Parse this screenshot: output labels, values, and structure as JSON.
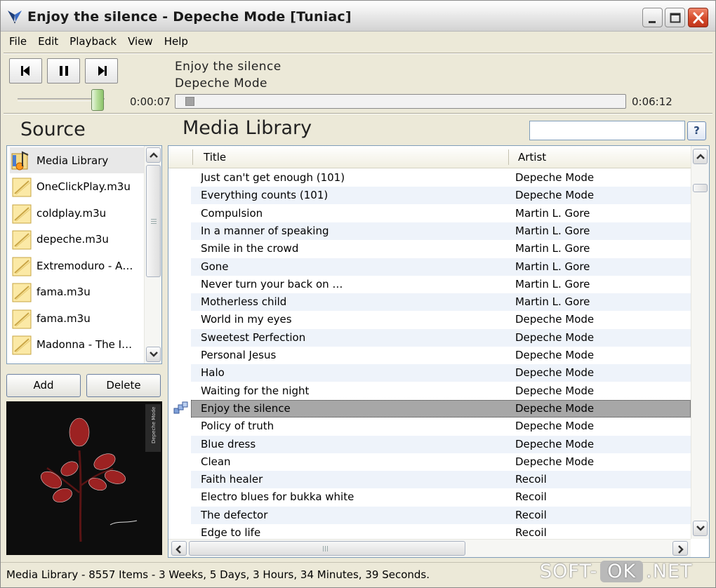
{
  "window": {
    "title": "Enjoy the silence - Depeche Mode [Tuniac]",
    "controls": [
      "minimize",
      "maximize",
      "close"
    ]
  },
  "menu": [
    "File",
    "Edit",
    "Playback",
    "View",
    "Help"
  ],
  "player": {
    "track_title": "Enjoy the silence",
    "track_artist": "Depeche Mode",
    "elapsed": "0:00:07",
    "total": "0:06:12",
    "progress_fraction": 0.019,
    "volume_fraction": 0.92,
    "buttons": [
      "previous-icon",
      "pause-icon",
      "next-icon"
    ]
  },
  "source": {
    "heading": "Source",
    "items": [
      {
        "label": "Media Library",
        "icon": "media-library-icon",
        "selected": true
      },
      {
        "label": "OneClickPlay.m3u",
        "icon": "playlist-icon"
      },
      {
        "label": "coldplay.m3u",
        "icon": "playlist-icon"
      },
      {
        "label": "depeche.m3u",
        "icon": "playlist-icon"
      },
      {
        "label": "Extremoduro - A…",
        "icon": "playlist-icon"
      },
      {
        "label": "fama.m3u",
        "icon": "playlist-icon"
      },
      {
        "label": "fama.m3u",
        "icon": "playlist-icon"
      },
      {
        "label": "Madonna - The I…",
        "icon": "playlist-icon"
      }
    ],
    "add_label": "Add",
    "delete_label": "Delete"
  },
  "library": {
    "heading": "Media Library",
    "search_value": "",
    "help_label": "?",
    "columns": [
      "Title",
      "Artist"
    ],
    "rows": [
      {
        "title": "Just can't get enough (101)",
        "artist": "Depeche Mode"
      },
      {
        "title": "Everything counts (101)",
        "artist": "Depeche Mode"
      },
      {
        "title": "Compulsion",
        "artist": "Martin L. Gore"
      },
      {
        "title": "In a manner of speaking",
        "artist": "Martin L. Gore"
      },
      {
        "title": "Smile in the crowd",
        "artist": "Martin L. Gore"
      },
      {
        "title": "Gone",
        "artist": "Martin L. Gore"
      },
      {
        "title": "Never turn your back on …",
        "artist": "Martin L. Gore"
      },
      {
        "title": "Motherless child",
        "artist": "Martin L. Gore"
      },
      {
        "title": "World in my eyes",
        "artist": "Depeche Mode"
      },
      {
        "title": "Sweetest Perfection",
        "artist": "Depeche Mode"
      },
      {
        "title": "Personal Jesus",
        "artist": "Depeche Mode"
      },
      {
        "title": "Halo",
        "artist": "Depeche Mode"
      },
      {
        "title": "Waiting for the night",
        "artist": "Depeche Mode"
      },
      {
        "title": "Enjoy the silence",
        "artist": "Depeche Mode",
        "playing": true
      },
      {
        "title": "Policy of truth",
        "artist": "Depeche Mode"
      },
      {
        "title": "Blue dress",
        "artist": "Depeche Mode"
      },
      {
        "title": "Clean",
        "artist": "Depeche Mode"
      },
      {
        "title": "Faith healer",
        "artist": "Recoil"
      },
      {
        "title": "Electro blues for bukka white",
        "artist": "Recoil"
      },
      {
        "title": "The defector",
        "artist": "Recoil"
      },
      {
        "title": "Edge to life",
        "artist": "Recoil"
      }
    ]
  },
  "status": "Media Library - 8557 Items - 3 Weeks, 5 Days, 3 Hours, 34 Minutes, 39 Seconds.",
  "watermark": {
    "prefix": "SOFT-",
    "middle": "OK",
    "suffix": ".NET"
  },
  "colors": {
    "alt_row": "#eef3fa",
    "current_row": "#a7a7a7",
    "close_button": "#d54a2a",
    "volume_thumb": "#b5dd98"
  }
}
